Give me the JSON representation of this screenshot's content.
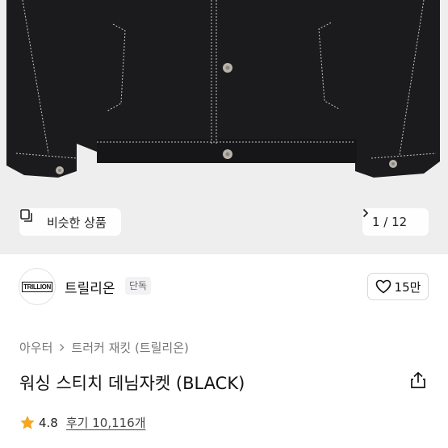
{
  "hero": {
    "image_desc": "black denim jacket product photo",
    "similar_button_label": "비슷한 상품",
    "similar_icon": "similar-products-icon",
    "page_indicator": "1 / 12",
    "next_icon": "chevron-right-icon",
    "bg_color": "#eeeeef"
  },
  "brand": {
    "logo_text": "TRILLION",
    "name": "트릴리온",
    "tag": "단독",
    "like_icon": "heart-icon",
    "like_count": "15만"
  },
  "product": {
    "category": [
      "아우터",
      "트러커 재킷 (트릴리온)"
    ],
    "title": "워싱 스티치 데님자켓 (BLACK)",
    "share_icon": "share-icon",
    "rating": "4.8",
    "reviews": "후기 10,116개",
    "star_color": "#f5a623"
  }
}
